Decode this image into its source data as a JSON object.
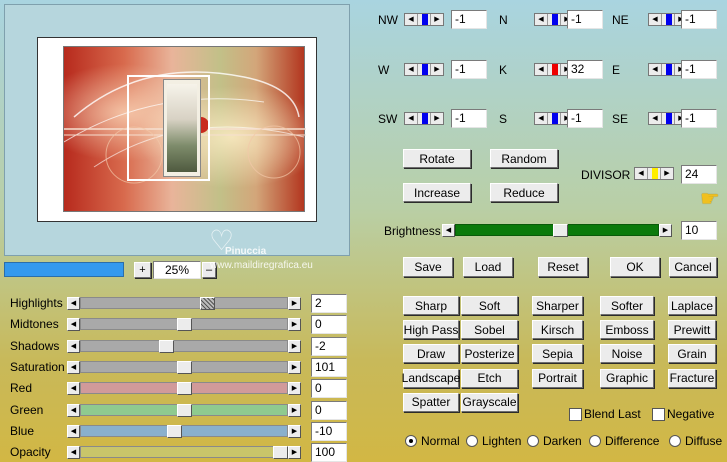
{
  "colors": {
    "progress": "#3399ee",
    "direction_marker": "#0000ee",
    "center_marker": "#ee0000",
    "divisor_marker": "#ffee00",
    "brightness_track": "#0b7a0b"
  },
  "preview": {
    "zoom_minus": "+",
    "zoom_value": "25%",
    "zoom_plus": "–",
    "progress_percent": 100
  },
  "watermark": {
    "name": "Pinuccia",
    "url": "www.maildiregrafica.eu"
  },
  "directions": [
    {
      "label": "NW",
      "value": "-1"
    },
    {
      "label": "N",
      "value": "-1"
    },
    {
      "label": "NE",
      "value": "-1"
    },
    {
      "label": "W",
      "value": "-1"
    },
    {
      "label": "K",
      "value": "32"
    },
    {
      "label": "E",
      "value": "-1"
    },
    {
      "label": "SW",
      "value": "-1"
    },
    {
      "label": "S",
      "value": "-1"
    },
    {
      "label": "SE",
      "value": "-1"
    }
  ],
  "buttons": {
    "rotate": "Rotate",
    "random": "Random",
    "increase": "Increase",
    "reduce": "Reduce",
    "save": "Save",
    "load": "Load",
    "reset": "Reset",
    "ok": "OK",
    "cancel": "Cancel"
  },
  "divisor": {
    "label": "DIVISOR",
    "value": "24"
  },
  "brightness": {
    "label": "Brightness",
    "value": "10",
    "level_percent": 52
  },
  "adjustments": [
    {
      "label": "Highlights",
      "value": "2",
      "level_percent": 62,
      "color": "#a9a9a9"
    },
    {
      "label": "Midtones",
      "value": "0",
      "level_percent": 50,
      "color": "#a9a9a9"
    },
    {
      "label": "Shadows",
      "value": "-2",
      "level_percent": 41,
      "color": "#a9a9a9"
    },
    {
      "label": "Saturation",
      "value": "101",
      "level_percent": 50,
      "color": "#a9a9a9"
    },
    {
      "label": "Red",
      "value": "0",
      "level_percent": 50,
      "color": "#d19a9a"
    },
    {
      "label": "Green",
      "value": "0",
      "level_percent": 50,
      "color": "#8fca8f"
    },
    {
      "label": "Blue",
      "value": "-10",
      "level_percent": 45,
      "color": "#8ab0cc"
    },
    {
      "label": "Opacity",
      "value": "100",
      "level_percent": 100,
      "color": "#c9c56a"
    }
  ],
  "filters": [
    [
      "Sharp",
      "Soft",
      "Sharper",
      "Softer",
      "Laplace"
    ],
    [
      "High Pass",
      "Sobel",
      "Kirsch",
      "Emboss",
      "Prewitt"
    ],
    [
      "Draw",
      "Posterize",
      "Sepia",
      "Noise",
      "Grain"
    ],
    [
      "Landscape",
      "Etch",
      "Portrait",
      "Graphic",
      "Fracture"
    ],
    [
      "Spatter",
      "Grayscale"
    ]
  ],
  "options": {
    "blend_last": "Blend Last",
    "negative": "Negative"
  },
  "blend_modes": [
    {
      "label": "Normal",
      "selected": true
    },
    {
      "label": "Lighten",
      "selected": false
    },
    {
      "label": "Darken",
      "selected": false
    },
    {
      "label": "Difference",
      "selected": false
    },
    {
      "label": "Diffuse",
      "selected": false
    }
  ]
}
